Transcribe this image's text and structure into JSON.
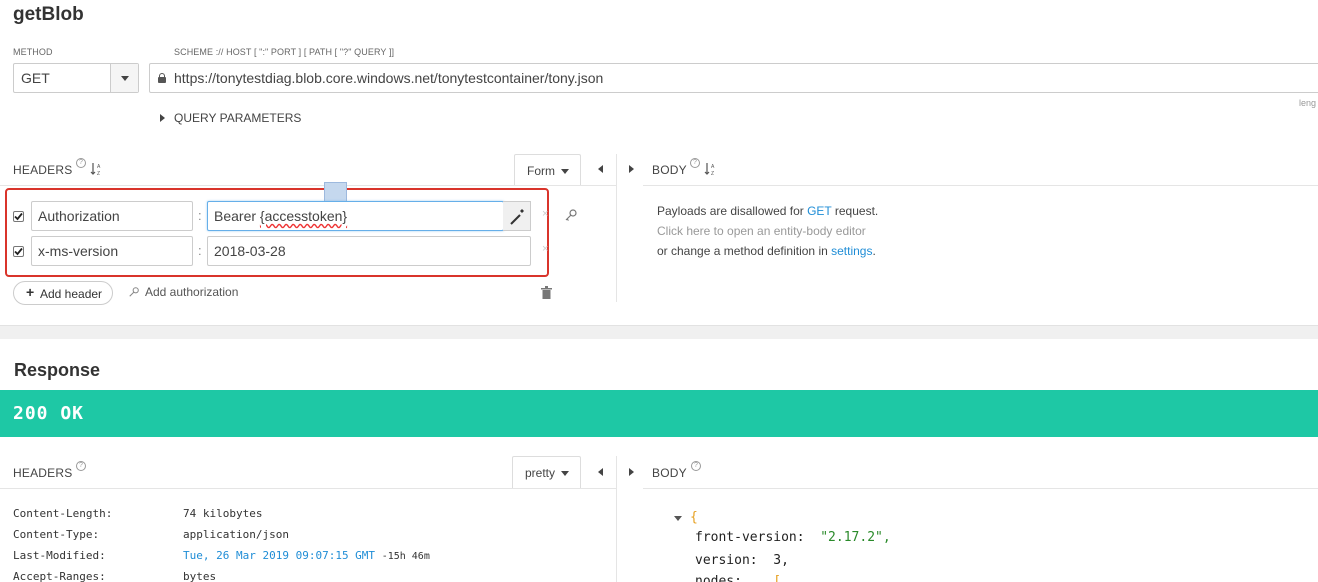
{
  "request": {
    "title": "getBlob",
    "method_label": "METHOD",
    "method_value": "GET",
    "url_label": "SCHEME :// HOST [ \":\" PORT ] [ PATH [ \"?\" QUERY ]]",
    "url_value": "https://tonytestdiag.blob.core.windows.net/tonytestcontainer/tony.json",
    "length_hint": "leng",
    "query_params_label": "QUERY PARAMETERS",
    "headers_label": "HEADERS",
    "headers_mode": "Form",
    "headers": [
      {
        "checked": true,
        "name": "Authorization",
        "value_prefix": "Bearer ",
        "value_token": "{accesstoken}"
      },
      {
        "checked": true,
        "name": "x-ms-version",
        "value": "2018-03-28"
      }
    ],
    "add_header_label": "Add header",
    "add_authorization_label": "Add authorization",
    "body_label": "BODY",
    "body_message": {
      "line1_prefix": "Payloads are disallowed for ",
      "line1_method": "GET",
      "line1_suffix": " request.",
      "line2": "Click here to open an entity-body editor",
      "line3_prefix": "or change a method definition in ",
      "line3_link": "settings",
      "line3_suffix": "."
    }
  },
  "response": {
    "title": "Response",
    "status": "200 OK",
    "status_color": "#1ec8a5",
    "headers_label": "HEADERS",
    "headers_mode": "pretty",
    "body_label": "BODY",
    "headers": [
      {
        "name": "Content-Length:",
        "value": "74 kilobytes"
      },
      {
        "name": "Content-Type:",
        "value": "application/json"
      },
      {
        "name": "Last-Modified:",
        "value": "Tue, 26 Mar 2019 09:07:15 GMT",
        "extra": "-15h 46m"
      },
      {
        "name": "Accept-Ranges:",
        "value": "bytes"
      }
    ],
    "json": {
      "open_brace": "{",
      "key1": "front-version:",
      "val1": "\"2.17.2\",",
      "key2": "version:",
      "val2": "3,",
      "key3": "nodes:",
      "val3": "["
    }
  },
  "icons": {
    "sort": "sort-alpha-icon",
    "help": "help-icon",
    "wand": "magic-wand-icon",
    "key": "key-icon",
    "trash": "trash-icon",
    "lock": "lock-icon"
  }
}
